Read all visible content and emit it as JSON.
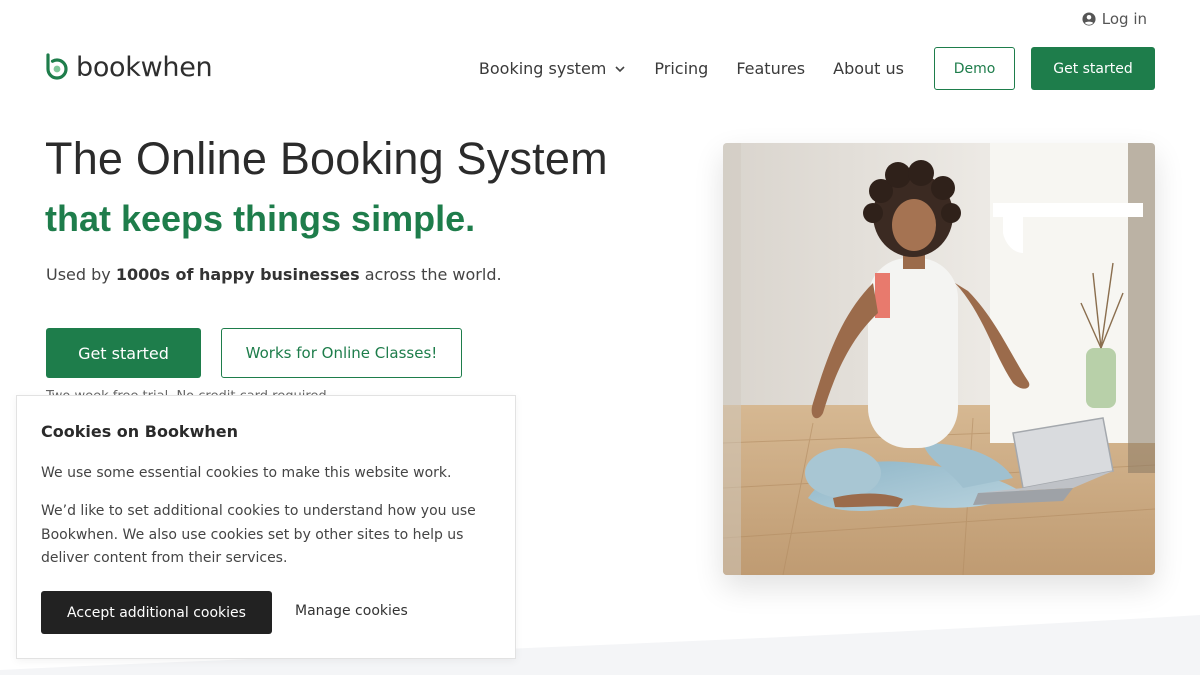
{
  "header": {
    "login_label": "Log in",
    "logo_text": "bookwhen",
    "nav": [
      {
        "label": "Booking system",
        "has_dropdown": true
      },
      {
        "label": "Pricing"
      },
      {
        "label": "Features"
      },
      {
        "label": "About us"
      }
    ],
    "demo_label": "Demo",
    "get_started_label": "Get started"
  },
  "hero": {
    "title": "The Online Booking System",
    "subtitle": "that keeps things simple.",
    "desc_prefix": "Used by ",
    "desc_bold": "1000s of happy businesses",
    "desc_suffix": " across the world.",
    "cta_primary": "Get started",
    "cta_secondary": "Works for Online Classes!",
    "trial_note": "Two week free trial. No credit card required."
  },
  "cookies": {
    "title": "Cookies on Bookwhen",
    "p1": "We use some essential cookies to make this website work.",
    "p2": "We’d like to set additional cookies to understand how you use Bookwhen. We also use cookies set by other sites to help us deliver content from their services.",
    "accept_label": "Accept additional cookies",
    "manage_label": "Manage cookies"
  },
  "colors": {
    "brand_green": "#1e7d4b",
    "dark_button": "#222222"
  }
}
